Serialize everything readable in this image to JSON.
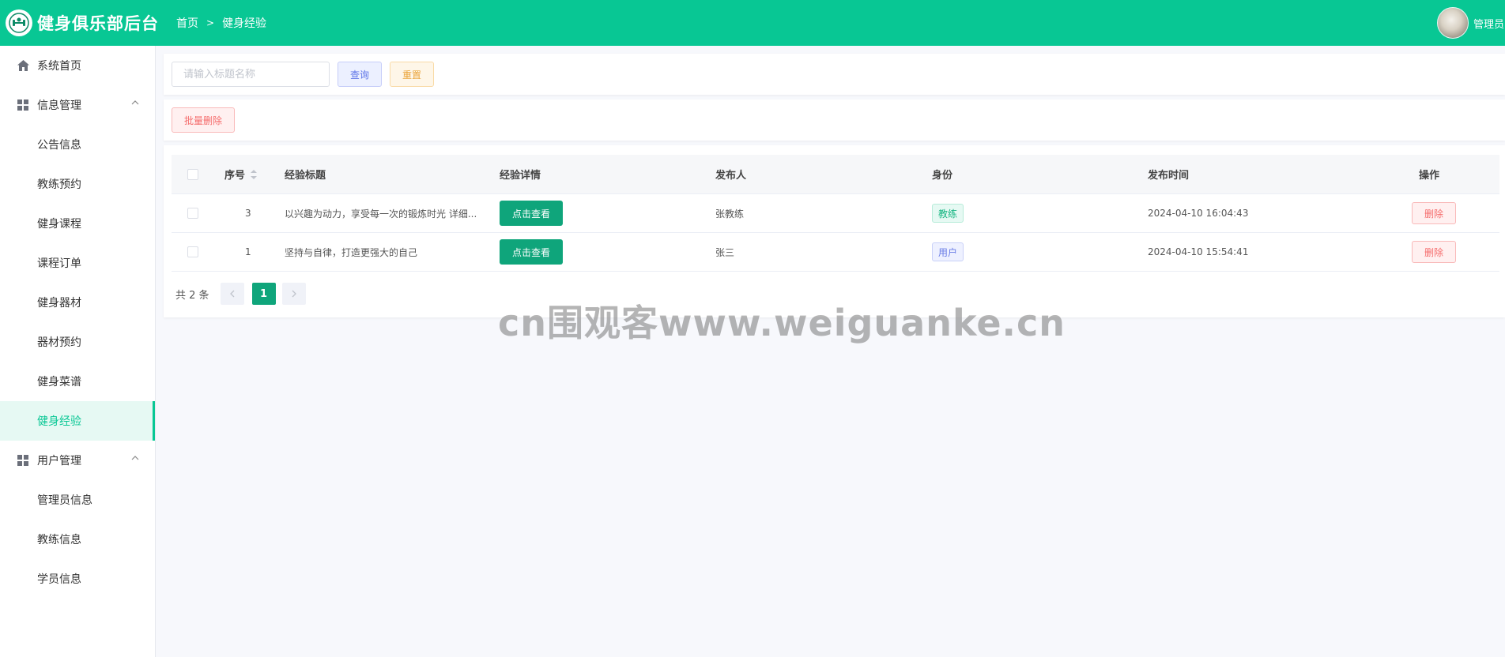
{
  "header": {
    "app_title": "健身俱乐部后台",
    "breadcrumb": [
      "首页",
      "健身经验"
    ],
    "user_name": "管理员"
  },
  "sidebar": {
    "home": "系统首页",
    "groups": [
      {
        "label": "信息管理",
        "items": [
          "公告信息",
          "教练预约",
          "健身课程",
          "课程订单",
          "健身器材",
          "器材预约",
          "健身菜谱",
          "健身经验"
        ]
      },
      {
        "label": "用户管理",
        "items": [
          "管理员信息",
          "教练信息",
          "学员信息"
        ]
      }
    ],
    "active_item": "健身经验"
  },
  "search": {
    "placeholder": "请输入标题名称",
    "query_label": "查询",
    "reset_label": "重置"
  },
  "actions": {
    "batch_delete_label": "批量删除"
  },
  "table": {
    "columns": [
      "序号",
      "经验标题",
      "经验详情",
      "发布人",
      "身份",
      "发布时间",
      "操作"
    ],
    "rows": [
      {
        "id": "3",
        "title": "以兴趣为动力，享受每一次的锻炼时光 详细...",
        "detail_button": "点击查看",
        "publisher": "张教练",
        "role": "教练",
        "time": "2024-04-10 16:04:43",
        "action": "删除"
      },
      {
        "id": "1",
        "title": "坚持与自律，打造更强大的自己",
        "detail_button": "点击查看",
        "publisher": "张三",
        "role": "用户",
        "time": "2024-04-10 15:54:41",
        "action": "删除"
      }
    ]
  },
  "pagination": {
    "total_text": "共 2 条",
    "current_page": "1"
  },
  "watermark": "cn围观客www.weiguanke.cn",
  "colors": {
    "primary": "#08c794",
    "button_green": "#0fa57b",
    "danger": "#f56c6c"
  }
}
